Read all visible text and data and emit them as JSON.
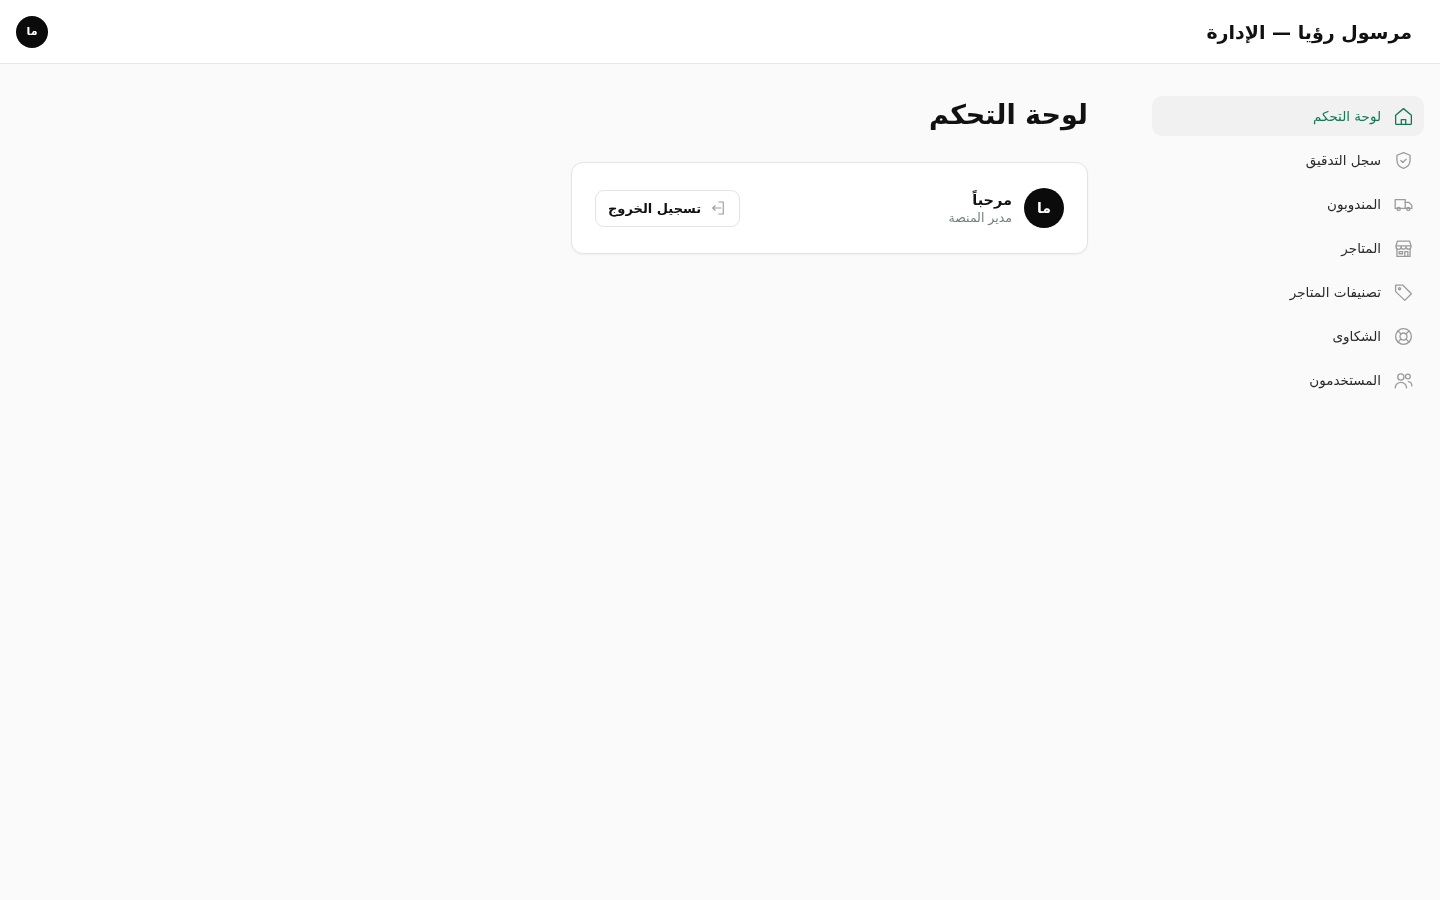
{
  "header": {
    "title": "مرسول رؤيا — الإدارة",
    "avatar": "ما"
  },
  "sidebar": {
    "items": [
      {
        "label": "لوحة التحكم",
        "selected": true
      },
      {
        "label": "سجل التدقيق",
        "selected": false
      },
      {
        "label": "المندوبون",
        "selected": false
      },
      {
        "label": "المتاجر",
        "selected": false
      },
      {
        "label": "تصنيفات المتاجر",
        "selected": false
      },
      {
        "label": "الشكاوى",
        "selected": false
      },
      {
        "label": "المستخدمون",
        "selected": false
      }
    ]
  },
  "page": {
    "title": "لوحة التحكم"
  },
  "profile_card": {
    "avatar": "ما",
    "greeting": "مرحباً",
    "role": "مدير المنصة",
    "logout_button": "تسجيل الخروج"
  }
}
